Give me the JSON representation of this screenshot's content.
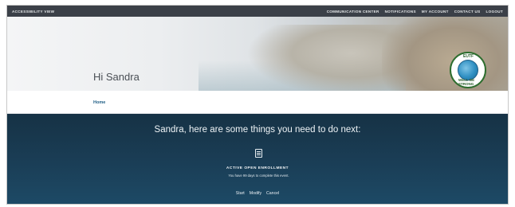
{
  "topbar": {
    "accessibility": "ACCESSIBILITY VIEW",
    "links": [
      "COMMUNICATION CENTER",
      "NOTIFICATIONS",
      "MY ACCOUNT",
      "CONTACT US",
      "LOGOUT"
    ]
  },
  "hero": {
    "greeting": "Hi Sandra",
    "logo_text_top": "EUTF",
    "logo_text_bottom": "WELL BE STRONG"
  },
  "breadcrumb": {
    "home": "Home"
  },
  "next_steps": {
    "heading": "Sandra, here are some things you need to do next:",
    "card_icon": "document-icon",
    "title": "ACTIVE OPEN ENROLLMENT",
    "description": "You have 99 days to complete this event.",
    "actions": [
      "Start",
      "Modify",
      "Cancel"
    ]
  },
  "colors": {
    "topbar": "#3b4048",
    "panel": "#1a3d55",
    "link": "#1f5e85"
  }
}
